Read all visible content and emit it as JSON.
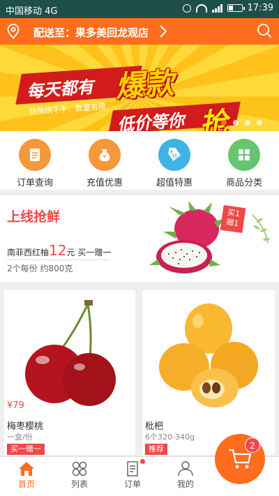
{
  "status_bar": {
    "carrier": "中国移动 4G",
    "time": "17:39"
  },
  "header": {
    "delivery_to": "配送至：果多美回龙观店"
  },
  "banner": {
    "line1": "每天都有",
    "line2": "爆款",
    "line3": "低价等你",
    "line4": "抢",
    "tagline": "快快快下手，数量有限",
    "slides": 4,
    "active_slide": 0
  },
  "quick_menu": [
    {
      "label": "订单查询",
      "icon": "order-list-icon",
      "color": "#f5983a"
    },
    {
      "label": "充值优惠",
      "icon": "money-bag-icon",
      "color": "#f5983a"
    },
    {
      "label": "超值特惠",
      "icon": "discount-tag-icon",
      "color": "#3fb2e6"
    },
    {
      "label": "商品分类",
      "icon": "category-grid-icon",
      "color": "#66c56e"
    }
  ],
  "promo": {
    "title": "上线抢鲜",
    "name": "南菲西红柚",
    "price": "12",
    "price_unit": "元",
    "offer": "买一赠一",
    "detail": "2个每份 约800克",
    "badge": "买1赠1"
  },
  "products": [
    {
      "price": "¥79",
      "name": "梅枣樱桃",
      "unit": "一盒/份",
      "tag": "买一赠一"
    },
    {
      "price": "",
      "name": "枇杷",
      "unit": "6个320-340g",
      "tag": "推荐"
    }
  ],
  "tabs": [
    {
      "label": "首页",
      "icon": "home-icon",
      "active": true
    },
    {
      "label": "列表",
      "icon": "list-grid-icon",
      "active": false
    },
    {
      "label": "订单",
      "icon": "order-icon",
      "active": false
    },
    {
      "label": "我的",
      "icon": "user-icon",
      "active": false
    }
  ],
  "cart": {
    "count": "2"
  },
  "colors": {
    "accent": "#ff6d1f",
    "red": "#f04848",
    "status_bar": "#1f4f4a"
  }
}
